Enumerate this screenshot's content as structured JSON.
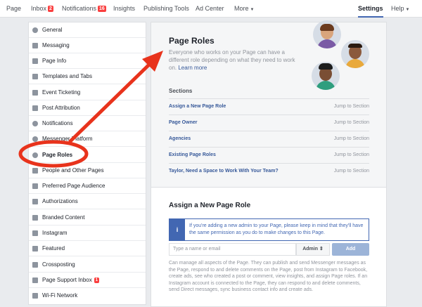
{
  "topnav": {
    "page": "Page",
    "inbox": "Inbox",
    "inbox_badge": "2",
    "notifications": "Notifications",
    "notifications_badge": "16",
    "insights": "Insights",
    "publishing_tools": "Publishing Tools",
    "ad_center": "Ad Center",
    "more": "More",
    "settings": "Settings",
    "help": "Help"
  },
  "sidebar": {
    "items": [
      {
        "label": "General",
        "icon": "gear-icon"
      },
      {
        "label": "Messaging",
        "icon": "messaging-icon"
      },
      {
        "label": "Page Info",
        "icon": "pencil-icon"
      },
      {
        "label": "Templates and Tabs",
        "icon": "grid-icon"
      },
      {
        "label": "Event Ticketing",
        "icon": "ticket-icon"
      },
      {
        "label": "Post Attribution",
        "icon": "flag-icon"
      },
      {
        "label": "Notifications",
        "icon": "globe-icon"
      },
      {
        "label": "Messenger Platform",
        "icon": "messenger-icon"
      },
      {
        "label": "Page Roles",
        "icon": "person-icon"
      },
      {
        "label": "People and Other Pages",
        "icon": "people-icon"
      },
      {
        "label": "Preferred Page Audience",
        "icon": "audience-icon"
      },
      {
        "label": "Authorizations",
        "icon": "wrench-icon"
      },
      {
        "label": "Branded Content",
        "icon": "handshake-icon"
      },
      {
        "label": "Instagram",
        "icon": "instagram-icon"
      },
      {
        "label": "Featured",
        "icon": "star-icon"
      },
      {
        "label": "Crossposting",
        "icon": "video-icon"
      },
      {
        "label": "Page Support Inbox",
        "icon": "inbox-icon",
        "badge": "1"
      },
      {
        "label": "Wi-Fi Network",
        "icon": "wifi-icon"
      }
    ]
  },
  "main": {
    "title": "Page Roles",
    "description": "Everyone who works on your Page can have a different role depending on what they need to work on.",
    "learn_more": "Learn more",
    "sections_label": "Sections",
    "jump_label": "Jump to Section",
    "sections": [
      "Assign a New Page Role",
      "Page Owner",
      "Agencies",
      "Existing Page Roles",
      "Taylor, Need a Space to Work With Your Team?"
    ],
    "assign_title": "Assign a New Page Role",
    "info_text": "If you're adding a new admin to your Page, please keep in mind that they'll have the same permission as you do to make changes to this Page.",
    "input_placeholder": "Type a name or email",
    "role_value": "Admin",
    "add_label": "Add",
    "footer_desc": "Can manage all aspects of the Page. They can publish and send Messenger messages as the Page, respond to and delete comments on the Page, post from Instagram to Facebook, create ads, see who created a post or comment, view insights, and assign Page roles. If an Instagram account is connected to the Page, they can respond to and delete comments, send Direct messages, sync business contact info and create ads."
  },
  "colors": {
    "brand_blue": "#4267b2",
    "link_blue": "#365899",
    "badge_red": "#fa3e3e",
    "annotation_red": "#e8331c"
  }
}
